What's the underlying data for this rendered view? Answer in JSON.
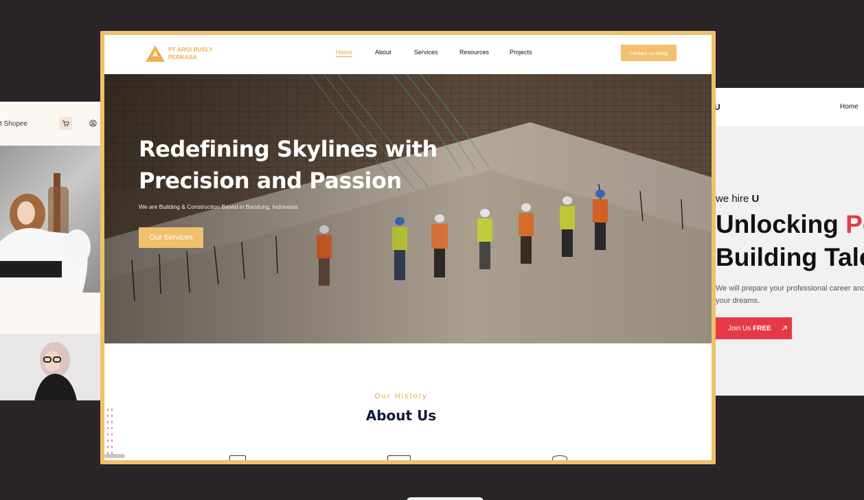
{
  "left_card": {
    "shop_label": "t Shopee",
    "cart_icon": "cart-icon",
    "user_icon": "user-circle-icon"
  },
  "main": {
    "brand": {
      "name": "PT ARGI RUSLY PERKASA",
      "icon": "triangle-logo-icon",
      "color": "#ecb04f"
    },
    "nav": {
      "items": [
        {
          "label": "Home",
          "active": true
        },
        {
          "label": "About",
          "active": false
        },
        {
          "label": "Services",
          "active": false
        },
        {
          "label": "Resources",
          "active": false
        },
        {
          "label": "Projects",
          "active": false
        }
      ],
      "cta": "Contact us today"
    },
    "hero": {
      "title": "Redefining Skylines with Precision and Passion",
      "subtitle": "We are Building & Construction Based in Bandung, Indonesia.",
      "button": "Our Services"
    },
    "history": {
      "eyebrow": "Our History",
      "title": "About Us"
    },
    "accent_color": "#f0c06c"
  },
  "right_card": {
    "logo_fragment": "U",
    "nav_home": "Home",
    "hire_prefix": "we hire ",
    "hire_emph": "U",
    "headline_line1": "Unlocking ",
    "headline_red": "Po",
    "headline_line2": "Building Tale",
    "description": "We will prepare your professional career and your dreams.",
    "join_prefix": "Join Us ",
    "join_emph": "FREE",
    "join_icon": "arrow-up-right-icon",
    "accent_color": "#e53a45"
  }
}
